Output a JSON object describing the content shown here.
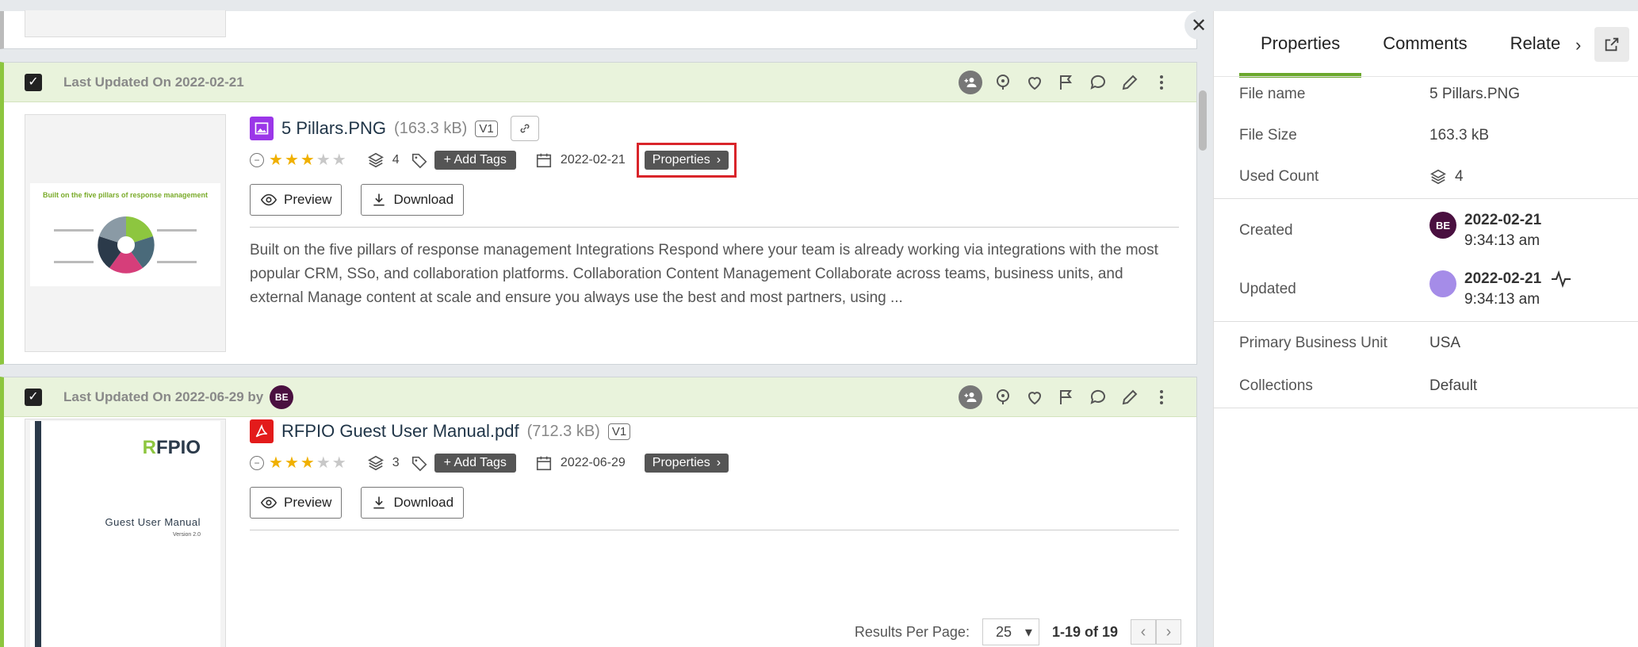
{
  "cards": [
    {
      "updated_label": "Last Updated On 2022-02-21",
      "updated_by": "",
      "title": "5 Pillars.PNG",
      "size": "(163.3 kB)",
      "version": "V1",
      "rating": 3,
      "used_count": "4",
      "add_tags_label": "+ Add Tags",
      "date": "2022-02-21",
      "properties_label": "Properties",
      "preview_label": "Preview",
      "download_label": "Download",
      "description": "Built on the five pillars of response management Integrations Respond where your team is already working via integrations with the most popular CRM, SSo, and collaboration platforms. Collaboration Content Management Collaborate across teams, business units, and external Manage content at scale and ensure you always use the best and most partners, using ...",
      "thumb_title": "Built on the five pillars of response management"
    },
    {
      "updated_label": "Last Updated On 2022-06-29 by",
      "updated_by": "BE",
      "title": "RFPIO Guest User Manual.pdf",
      "size": "(712.3 kB)",
      "version": "V1",
      "rating": 3,
      "used_count": "3",
      "add_tags_label": "+ Add Tags",
      "date": "2022-06-29",
      "properties_label": "Properties",
      "preview_label": "Preview",
      "download_label": "Download",
      "thumb_logo_a": "R",
      "thumb_logo_b": "FPIO",
      "thumb_subtitle": "Guest User Manual",
      "thumb_version": "Version 2.0"
    }
  ],
  "footer": {
    "results_per_page_label": "Results Per Page:",
    "per_page": "25",
    "range": "1-19 of 19"
  },
  "panel": {
    "tabs": [
      "Properties",
      "Comments",
      "Relate"
    ],
    "file_name_label": "File name",
    "file_name": "5 Pillars.PNG",
    "file_size_label": "File Size",
    "file_size": "163.3 kB",
    "used_count_label": "Used Count",
    "used_count": "4",
    "created_label": "Created",
    "created_avatar": "BE",
    "created_date": "2022-02-21",
    "created_time": "9:34:13 am",
    "updated_label": "Updated",
    "updated_date": "2022-02-21",
    "updated_time": "9:34:13 am",
    "bu_label": "Primary Business Unit",
    "bu_value": "USA",
    "collections_label": "Collections",
    "collections_value": "Default"
  },
  "colors": {
    "accent": "#8dc63f",
    "highlight": "#d9242a",
    "star": "#f0b000"
  }
}
